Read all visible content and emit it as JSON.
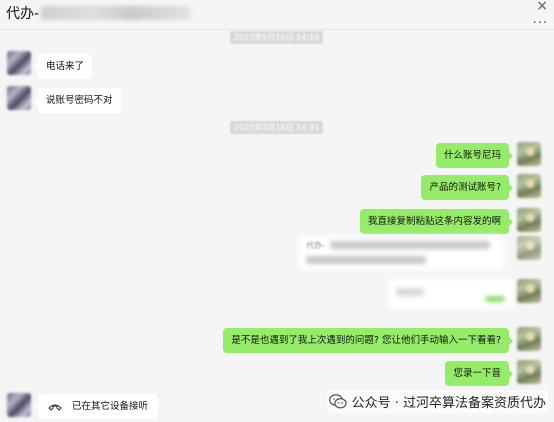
{
  "header": {
    "title": "代办-",
    "close_symbol": "×",
    "more_symbol": "..."
  },
  "timestamps": [
    "2025年5月10日 14:10",
    "2025年5月16日 14:31"
  ],
  "messages": [
    {
      "side": "left",
      "text": "电话来了"
    },
    {
      "side": "left",
      "text": "说账号密码不对"
    },
    {
      "side": "right",
      "text": "什么账号尼玛"
    },
    {
      "side": "right",
      "text": "产品的测试账号?"
    },
    {
      "side": "right",
      "text": "我直接复制粘贴这条内容发的啊"
    },
    {
      "side": "left",
      "text": "代办-"
    },
    {
      "side": "right",
      "text": "是不是也遇到了我上次遇到的问题? 您让他们手动输入一下看看?"
    },
    {
      "side": "right",
      "text": "您录一下音"
    }
  ],
  "call": {
    "text": "已在其它设备接听",
    "icon": "phone-hangup-icon"
  },
  "watermark": {
    "text": "公众号 · 过河卒算法备案资质代办",
    "icon": "wechat-icon"
  },
  "colors": {
    "green_bubble": "#95ec69",
    "white_bubble": "#ffffff",
    "background": "#f5f5f5"
  }
}
